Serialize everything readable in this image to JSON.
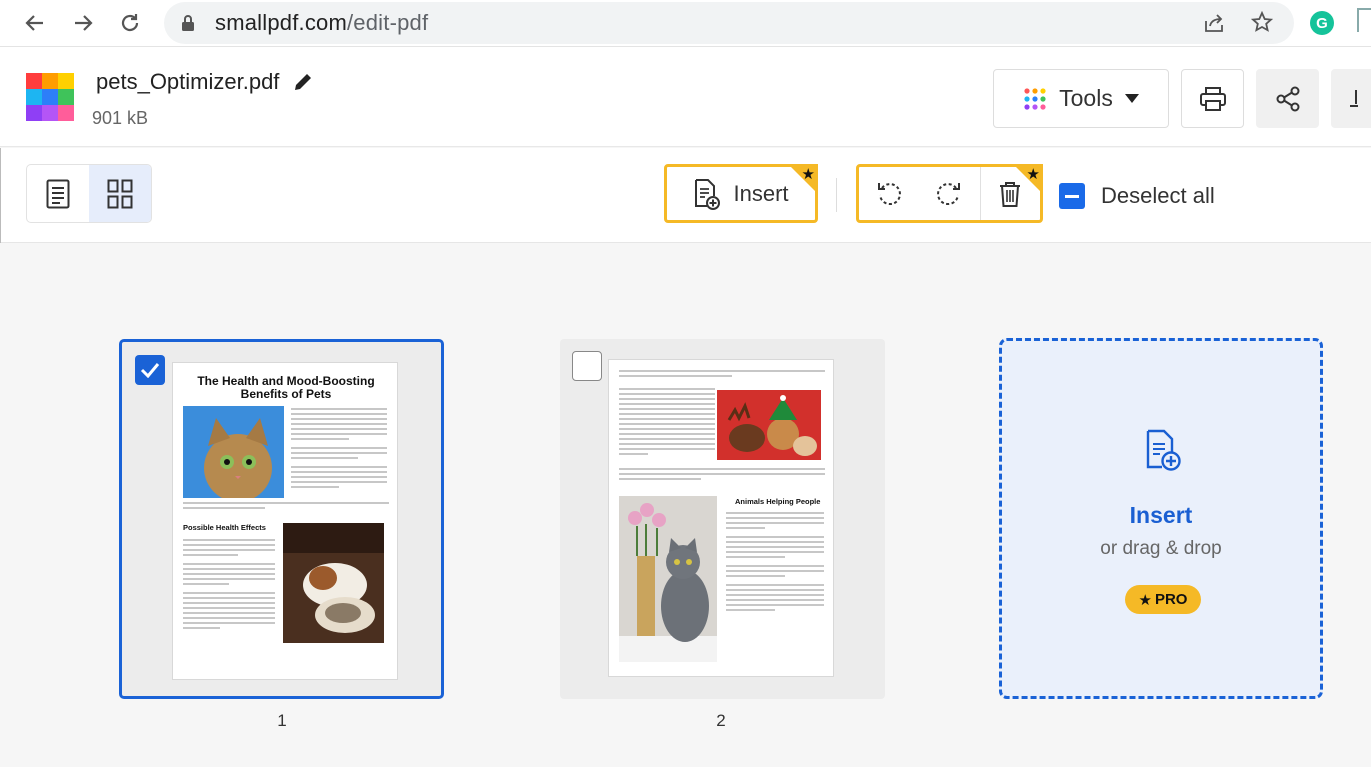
{
  "browser": {
    "url_domain": "smallpdf.com",
    "url_path": "/edit-pdf",
    "icons": [
      "back-arrow-icon",
      "forward-arrow-icon",
      "reload-icon",
      "lock-icon",
      "share-page-icon",
      "bookmark-star-icon",
      "grammarly-extension-icon"
    ]
  },
  "header": {
    "file_name": "pets_Optimizer.pdf",
    "file_size": "901 kB",
    "tools_label": "Tools",
    "logo_colors": [
      "#ff3d3d",
      "#ff9d00",
      "#ffd000",
      "#1db5f2",
      "#2d7ff9",
      "#3fc35a",
      "#8f3ff5",
      "#b455f6",
      "#ff5d9a"
    ]
  },
  "toolbar": {
    "insert_label": "Insert",
    "deselect_label": "Deselect all"
  },
  "pages": [
    {
      "number": "1",
      "selected": true,
      "title": "The Health and Mood-Boosting Benefits of Pets",
      "section_heading": "Possible Health Effects"
    },
    {
      "number": "2",
      "selected": false,
      "section_heading": "Animals Helping People"
    }
  ],
  "dropzone": {
    "title": "Insert",
    "subtitle": "or drag & drop",
    "badge": "PRO"
  },
  "colors": {
    "accent_blue": "#1a62d6",
    "pro_yellow": "#f5b926"
  }
}
